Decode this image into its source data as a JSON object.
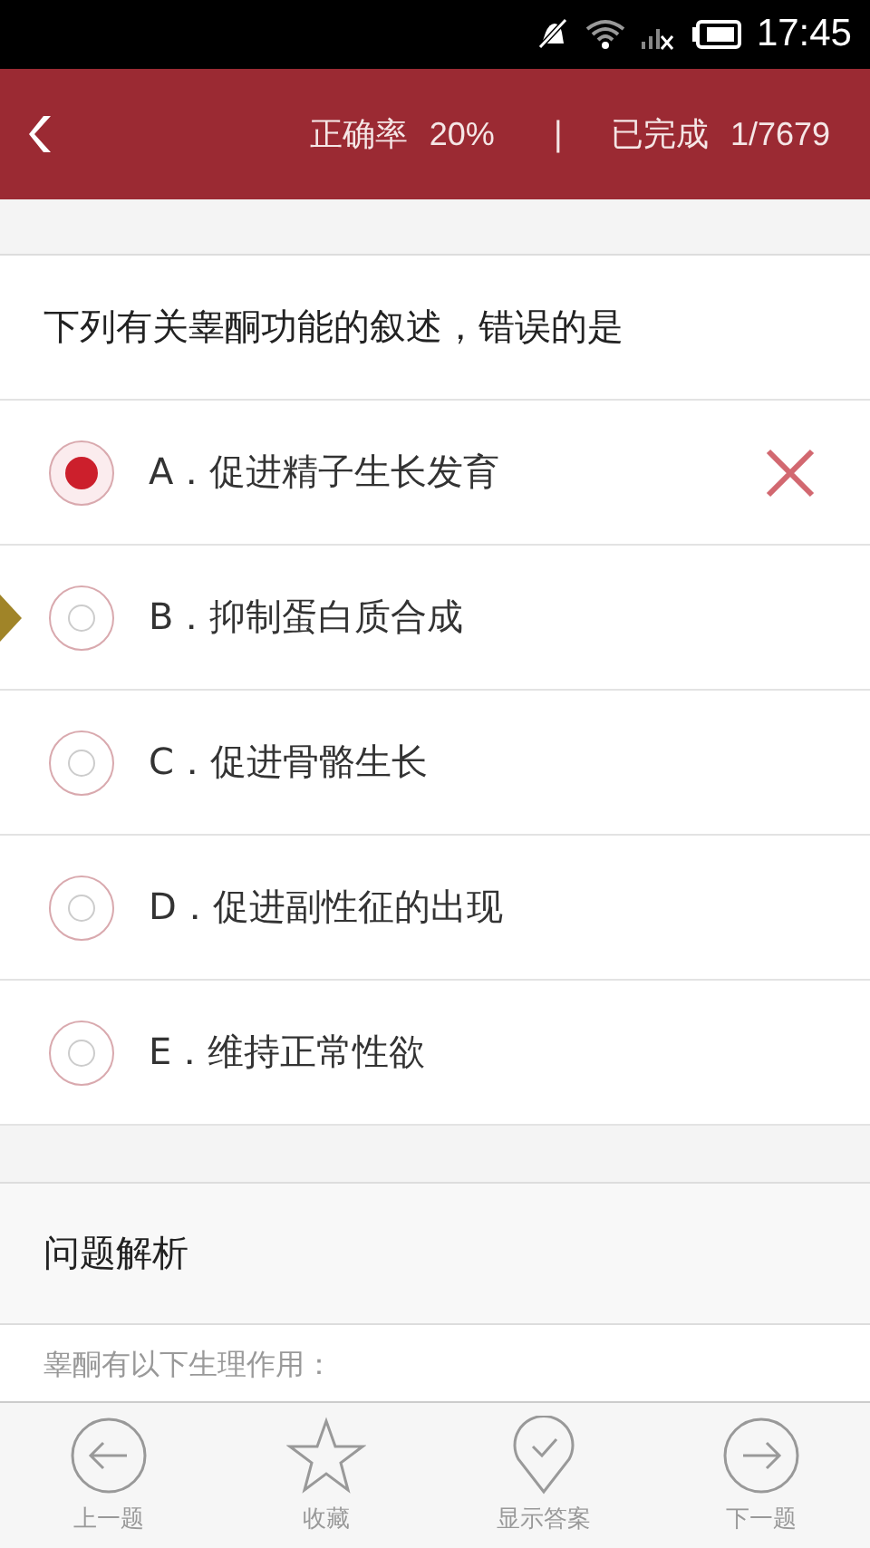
{
  "status_bar": {
    "time": "17:45"
  },
  "header": {
    "accuracy_label": "正确率",
    "accuracy": "20%",
    "separator": "|",
    "done_label": "已完成",
    "done": "1/7679"
  },
  "question": "下列有关睾酮功能的叙述，错误的是",
  "options": [
    {
      "text": "A．促进精子生长发育",
      "selected": true,
      "wrong": true,
      "pointer": false
    },
    {
      "text": "B．抑制蛋白质合成",
      "selected": false,
      "wrong": false,
      "pointer": true
    },
    {
      "text": "C．促进骨骼生长",
      "selected": false,
      "wrong": false,
      "pointer": false
    },
    {
      "text": "D．促进副性征的出现",
      "selected": false,
      "wrong": false,
      "pointer": false
    },
    {
      "text": "E．维持正常性欲",
      "selected": false,
      "wrong": false,
      "pointer": false
    }
  ],
  "analysis": {
    "title": "问题解析",
    "text": "睾酮有以下生理作用："
  },
  "toolbar": [
    {
      "kind": "prev",
      "label": "上一题"
    },
    {
      "kind": "star",
      "label": "收藏"
    },
    {
      "kind": "answer",
      "label": "显示答案"
    },
    {
      "kind": "next",
      "label": "下一题"
    }
  ]
}
